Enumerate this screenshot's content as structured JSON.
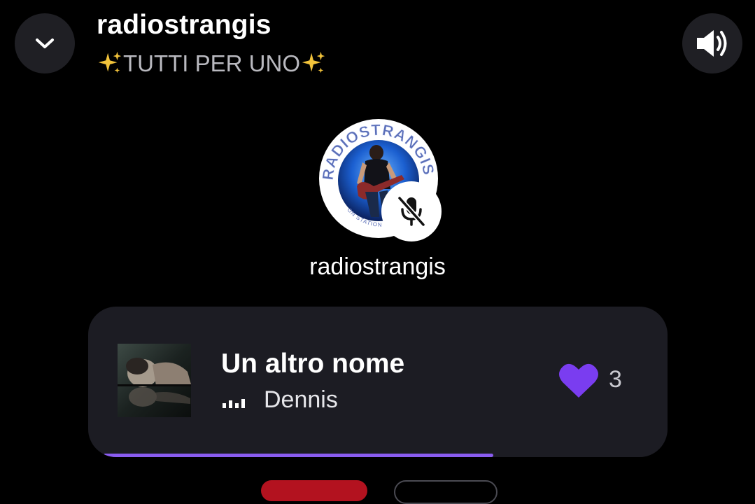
{
  "header": {
    "title": "radiostrangis",
    "subtitle": "TUTTI PER UNO",
    "subtitle_sparkle_icon": "sparkles-icon"
  },
  "controls": {
    "collapse_icon": "chevron-down-icon",
    "volume_icon": "speaker-volume-icon"
  },
  "host": {
    "name": "radiostrangis",
    "avatar_text": "RADIOSTRANGIS",
    "avatar_subtext": "ON STATION",
    "status_icon": "microphone-muted-icon"
  },
  "now_playing": {
    "title": "Un altro nome",
    "artist": "Dennis",
    "playing_icon": "equalizer-bars-icon",
    "like_icon": "heart-icon",
    "likes": "3",
    "progress": 0.71
  },
  "colors": {
    "background": "#000000",
    "card": "#1c1c23",
    "accent": "#8a5cf0",
    "heart": "#7a3df0",
    "red_button": "#b3121f"
  }
}
